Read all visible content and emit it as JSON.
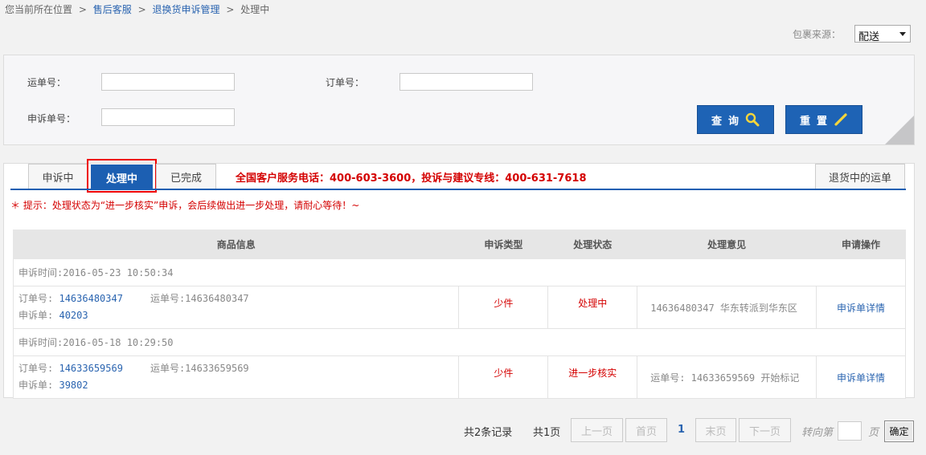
{
  "breadcrumb": {
    "prefix": "您当前所在位置",
    "items": [
      "售后客服",
      "退换货申诉管理"
    ],
    "current": "处理中",
    "separator": ">"
  },
  "source": {
    "label": "包裹来源：",
    "value": "配送"
  },
  "search": {
    "waybill_label": "运单号：",
    "waybill_value": "",
    "order_label": "订单号：",
    "order_value": "",
    "complaint_label": "申诉单号：",
    "complaint_value": "",
    "query_button": "查询",
    "reset_button": "重置"
  },
  "tabs": {
    "items": [
      "申诉中",
      "处理中",
      "已完成"
    ],
    "active": "处理中",
    "returning_button": "退货中的运单"
  },
  "hotline": "全国客户服务电话：400-603-3600，投诉与建议专线：400-631-7618",
  "tip": "＊ 提示：处理状态为“进一步核实”申诉，会后续做出进一步处理，请耐心等待！~",
  "table": {
    "headers": [
      "商品信息",
      "申诉类型",
      "处理状态",
      "处理意见",
      "申请操作"
    ],
    "rows": [
      {
        "time": "申诉时间:2016-05-23 10:50:34",
        "order_label": "订单号:",
        "order_no": "14636480347",
        "waybill_text": "运单号:14636480347",
        "complaint_label": "申诉单:",
        "complaint_no": "40203",
        "type": "少件",
        "status": "处理中",
        "opinion": "14636480347 华东转派到华东区",
        "action": "申诉单详情"
      },
      {
        "time": "申诉时间:2016-05-18 10:29:50",
        "order_label": "订单号:",
        "order_no": "14633659569",
        "waybill_text": "运单号:14633659569",
        "complaint_label": "申诉单:",
        "complaint_no": "39802",
        "type": "少件",
        "status": "进一步核实",
        "opinion": "运单号: 14633659569 开始标记",
        "action": "申诉单详情"
      }
    ]
  },
  "pagination": {
    "total_records": "共2条记录",
    "total_pages": "共1页",
    "prev": "上一页",
    "first": "首页",
    "current": "1",
    "last": "末页",
    "next": "下一页",
    "goto_label": "转向第",
    "goto_value": "",
    "page_unit": "页",
    "confirm": "确定"
  },
  "colors": {
    "accent": "#1c5fb2",
    "alert": "#d40000",
    "link": "#2a64b0"
  }
}
